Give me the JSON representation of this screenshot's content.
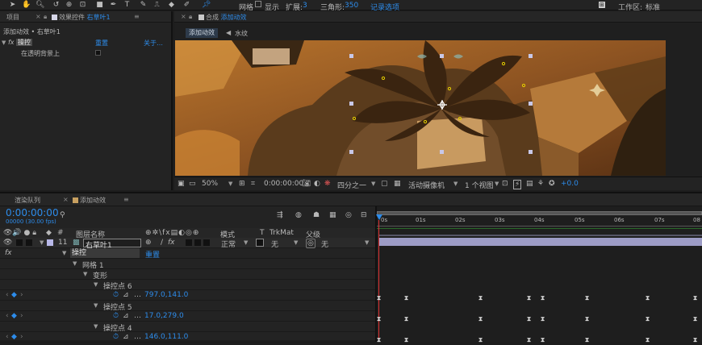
{
  "toolbar": {
    "snap_label": "网格",
    "show_label": "显示",
    "expand_label": "扩展:",
    "expand_value": "3",
    "triangles_label": "三角形:",
    "triangles_value": "350",
    "record_label": "记录选项",
    "workspace_label": "工作区:",
    "workspace_value": "标准"
  },
  "project_panel": {
    "tab_project": "项目",
    "tab_effects": "效果控件 ",
    "tab_effects_layer": "右草叶1",
    "breadcrumb": "添加动效 • 右草叶1",
    "effect_name": "操控",
    "reset_label": "重置",
    "about_label": "关于…",
    "option_label": "在透明背景上"
  },
  "comp_panel": {
    "tab_prefix": "合成 ",
    "tab_name": "添加动效",
    "crumb_active": "添加动效",
    "crumb_next": "水纹"
  },
  "comp_bar": {
    "zoom": "50%",
    "timecode": "0:00:00:00",
    "resolution": "四分之一",
    "camera": "活动摄像机",
    "views": "1 个视图",
    "exposure": "+0.0"
  },
  "timeline": {
    "tab_render": "渲染队列",
    "tab_comp": "添加动效",
    "timecode": "0:00:00:00",
    "frames": "00000 (30.00 fps)",
    "col_layer_name": "图层名称",
    "col_mode": "模式",
    "col_t": "T",
    "col_trkmat": "TrkMat",
    "col_parent": "父级",
    "layer_index": "11",
    "layer_name": "右草叶1",
    "layer_mode": "正常",
    "trkmat_value": "无",
    "parent_value": "无",
    "effect_row": "操控",
    "effect_reset": "重置",
    "mesh_label": "网格 1",
    "deform_label": "变形",
    "pin6_label": "操控点 6",
    "pin6_value": "797.0,141.0",
    "pin5_label": "操控点 5",
    "pin5_value": "17.0,279.0",
    "pin4_label": "操控点 4",
    "pin4_value": "146.0,111.0",
    "ruler": [
      "0s",
      "01s",
      "02s",
      "03s",
      "04s",
      "05s",
      "06s",
      "07s",
      "08"
    ]
  },
  "colors": {
    "accent_blue": "#2d8ceb",
    "playhead": "#2d8ceb",
    "layer_bar": "#9d9cc6"
  }
}
